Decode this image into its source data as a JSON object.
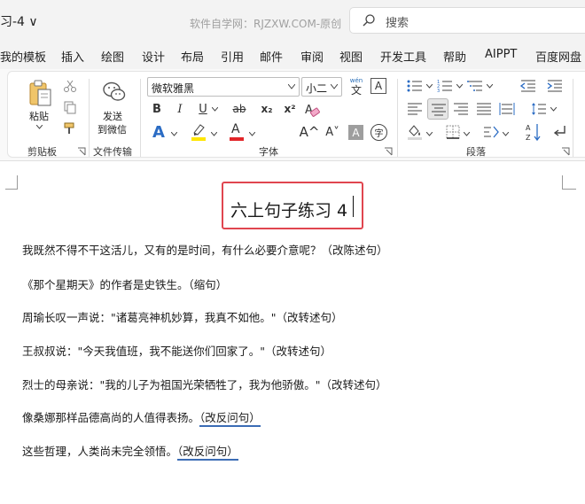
{
  "titlebar": {
    "doc_title": "习-4 ∨",
    "watermark": "软件自学网：RJZXW.COM-原创",
    "search_placeholder": "搜索"
  },
  "menu": {
    "items": [
      "我的模板",
      "插入",
      "绘图",
      "设计",
      "布局",
      "引用",
      "邮件",
      "审阅",
      "视图",
      "开发工具",
      "帮助",
      "AIPPT",
      "百度网盘"
    ]
  },
  "ribbon": {
    "clipboard": {
      "paste_label": "粘贴",
      "group_label": "剪贴板"
    },
    "transfer": {
      "send_label_1": "发送",
      "send_label_2": "到微信",
      "group_label": "文件传输"
    },
    "font": {
      "font_name": "微软雅黑",
      "font_size": "小二",
      "wen_icon_text": "wén",
      "wen_icon_char": "文",
      "bold": "B",
      "italic": "I",
      "underline": "U",
      "strike": "ab",
      "subscript": "x₂",
      "superscript": "x²",
      "text_effect": "A",
      "highlight": "ab",
      "font_color": "A",
      "grow": "A^",
      "shrink": "A˅",
      "shade": "A",
      "enclose": "字",
      "group_label": "字体",
      "highlight_color": "#ffe600",
      "font_color_value": "#e2262a"
    },
    "paragraph": {
      "group_label": "段落"
    }
  },
  "document": {
    "heading": "六上句子练习 4",
    "paragraphs": [
      {
        "text": "我既然不得不干这活儿，又有的是时间，有什么必要介意呢？（改陈述句）",
        "marked": ""
      },
      {
        "text": "《那个星期天》的作者是史铁生。（缩句）",
        "marked": ""
      },
      {
        "text": "周瑜长叹一声说：\"诸葛亮神机妙算，我真不如他。\"（改转述句）",
        "marked": ""
      },
      {
        "text": "王叔叔说：\"今天我值班，我不能送你们回家了。\"（改转述句）",
        "marked": ""
      },
      {
        "text": "烈士的母亲说：\"我的儿子为祖国光荣牺牲了，我为他骄傲。\"（改转述句）",
        "marked": ""
      },
      {
        "text": "像桑娜那样品德高尚的人值得表扬。",
        "marked": "（改反问句）"
      },
      {
        "text": "这些哲理，人类尚未完全领悟。",
        "marked": "（改反问句）"
      }
    ]
  }
}
